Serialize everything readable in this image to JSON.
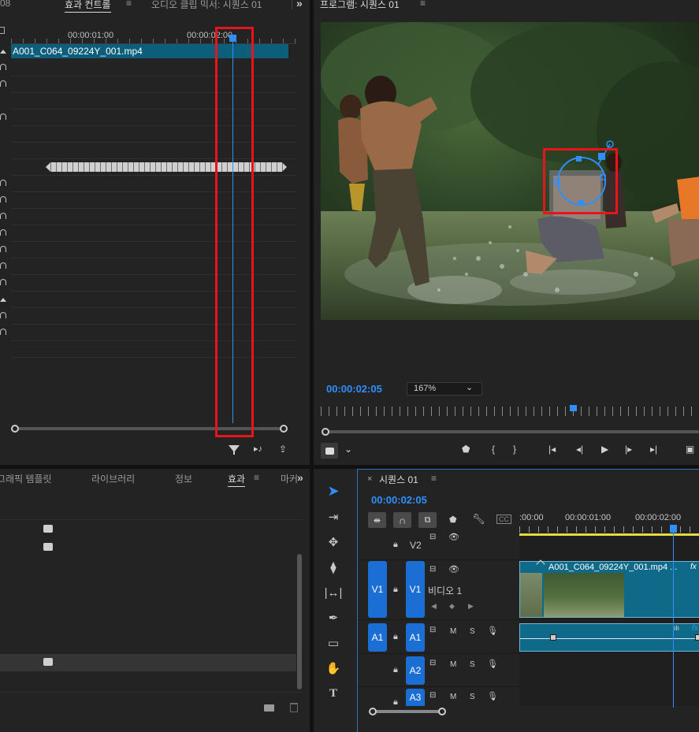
{
  "effect_controls": {
    "panel_num": "08",
    "tab_effect_controls": "효과 컨트롤",
    "tab_audio_mixer": "오디오 클립 믹서: 시퀀스 01",
    "ruler_time_1": "00:00:01:00",
    "ruler_time_2": "00:00:02:00",
    "clip_name": "A001_C064_09224Y_001.mp4"
  },
  "program_monitor": {
    "title": "프로그램: 시퀀스 01",
    "timecode": "00:00:02:05",
    "zoom": "167%"
  },
  "effects_panel": {
    "tab_graphics": "그래픽 템플릿",
    "tab_libraries": "라이브러리",
    "tab_info": "정보",
    "tab_effects": "효과",
    "tab_markers": "마커"
  },
  "timeline": {
    "sequence_name": "시퀀스 01",
    "timecode": "00:00:02:05",
    "ruler_labels": [
      ":00:00",
      "00:00:01:00",
      "00:00:02:00"
    ],
    "tracks": {
      "v2": "V2",
      "v1": "V1",
      "v1_source": "V1",
      "v1_name": "비디오 1",
      "a1": "A1",
      "a1_source": "A1",
      "a2": "A2",
      "a3": "A3",
      "m": "M",
      "s": "S"
    },
    "clip_name": "A001_C064_09224Y_001.mp4 ...",
    "fx": "fx"
  },
  "icons": {
    "close": "×",
    "menu": "≡",
    "overflow": "»"
  },
  "colors": {
    "accent": "#1b6fd4",
    "playhead": "#2f8fff",
    "clip_blue": "#0f6a8a",
    "highlight_red": "#e8141c",
    "ruler_yellow": "#e5d840"
  }
}
